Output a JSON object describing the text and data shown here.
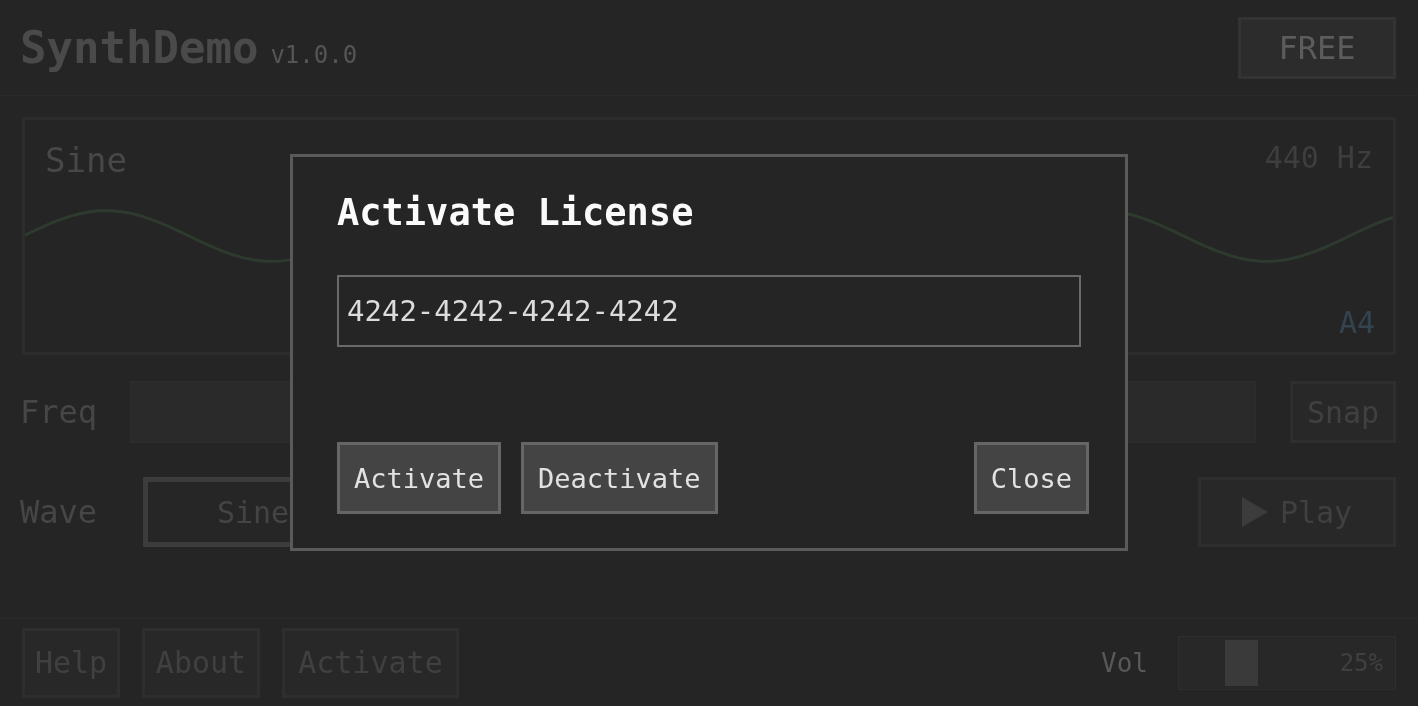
{
  "app": {
    "title": "SynthDemo",
    "version": "v1.0.0",
    "license_badge": "FREE"
  },
  "wave_display": {
    "wave_name": "Sine",
    "frequency": "440 Hz",
    "note": "A4"
  },
  "freq": {
    "label": "Freq",
    "snap_button": "Snap"
  },
  "wave": {
    "label": "Wave",
    "options": [
      {
        "label": "Sine",
        "selected": true
      }
    ],
    "play_button": "Play"
  },
  "footer": {
    "buttons": [
      "Help",
      "About",
      "Activate"
    ],
    "volume": {
      "label": "Vol",
      "level": 0.25,
      "reading": "25%"
    }
  },
  "dialog": {
    "title": "Activate License",
    "license_field": {
      "value": "4242-4242-4242-4242"
    },
    "buttons": [
      {
        "label": "Activate",
        "kind": "action"
      },
      {
        "label": "Deactivate",
        "kind": "action"
      },
      {
        "label": "Close",
        "kind": "dismiss"
      }
    ]
  }
}
